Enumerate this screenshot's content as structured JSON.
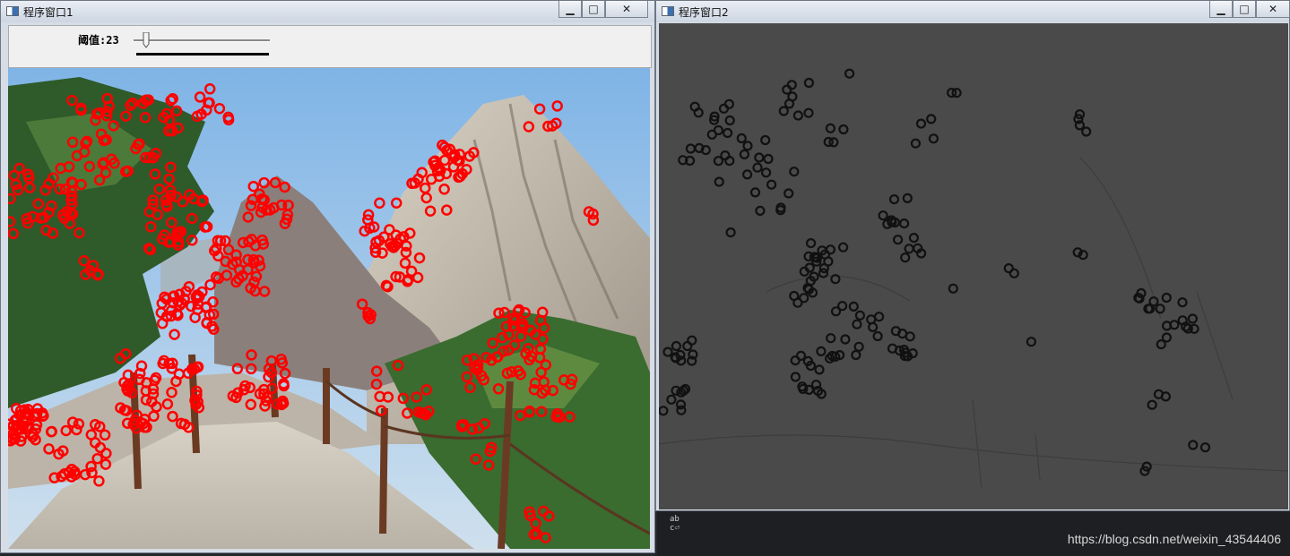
{
  "window1": {
    "title": "程序窗口1",
    "controls": {
      "minimize": "▁",
      "maximize": "□",
      "close": "✕"
    },
    "trackbar": {
      "label": "阈值:",
      "value": "23",
      "min": 0,
      "max": 255
    }
  },
  "window2": {
    "title": "程序窗口2",
    "controls": {
      "minimize": "▁",
      "maximize": "□",
      "close": "✕"
    }
  },
  "console": {
    "icon_text": "ab\nc⏎"
  },
  "watermark": "https://blog.csdn.net/weixin_43544406",
  "colors": {
    "keypoint_color": "#ff0000",
    "result_bg": "#4a4a4a",
    "result_keypoint": "#111111"
  }
}
